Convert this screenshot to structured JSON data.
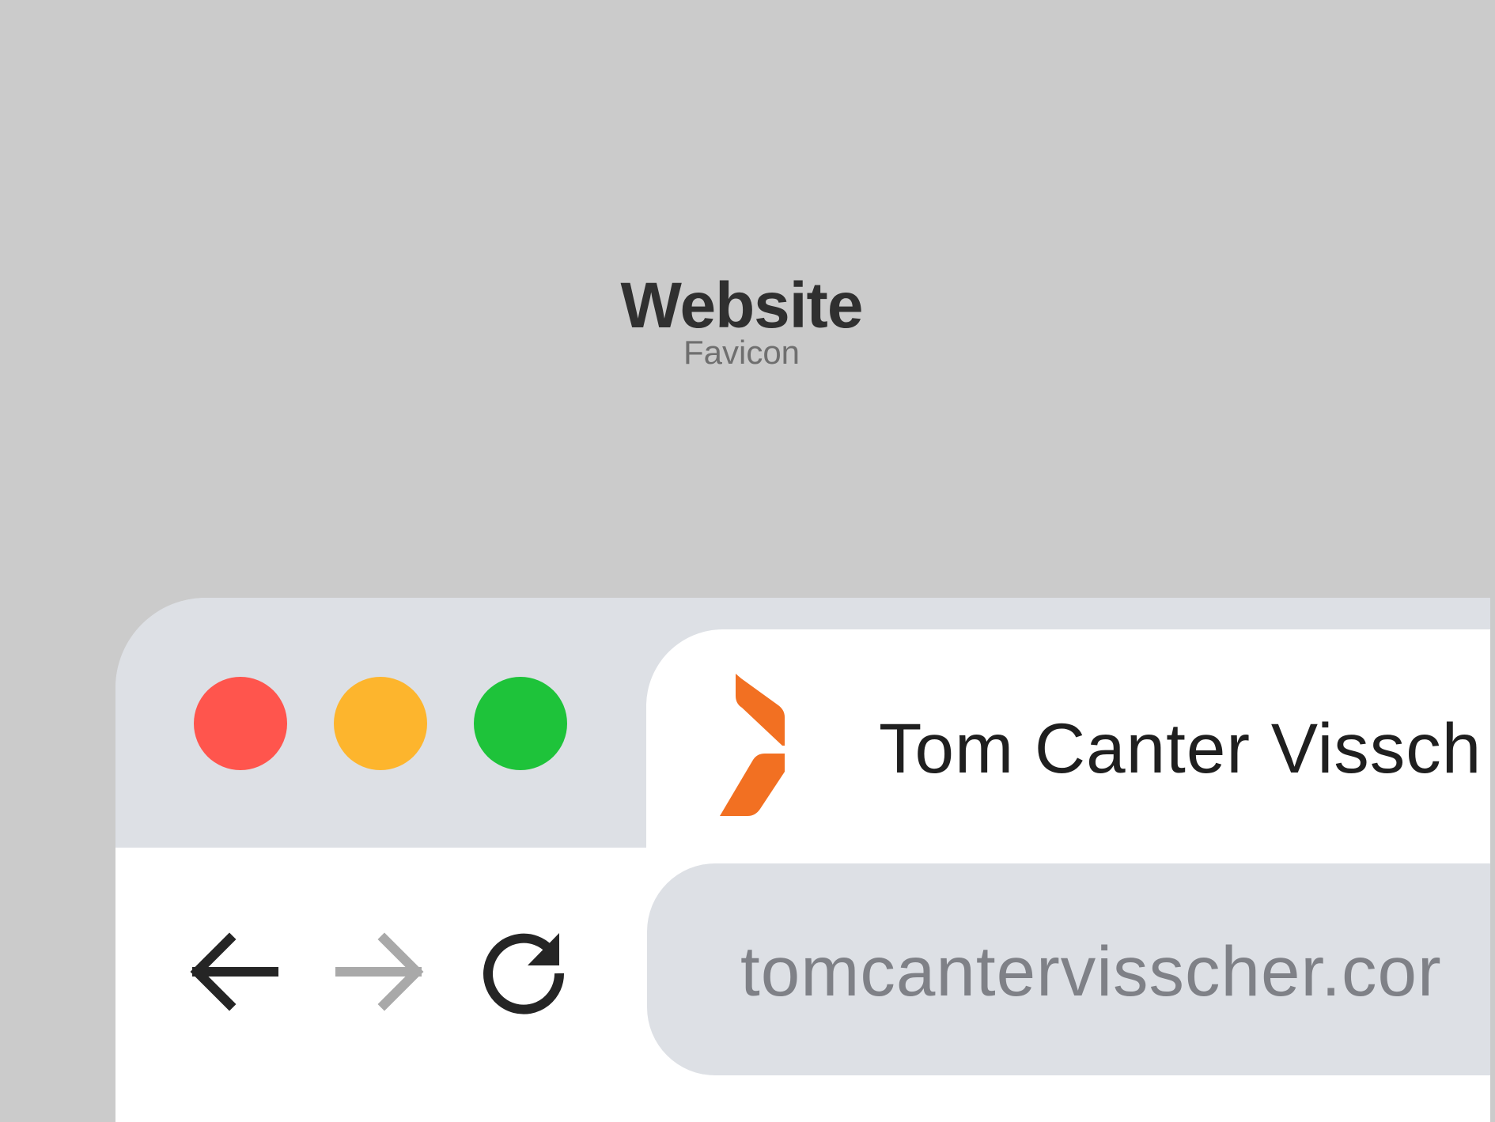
{
  "header": {
    "title": "Website",
    "subtitle": "Favicon"
  },
  "browser": {
    "tab_title": "Tom Canter Vissch",
    "address": "tomcantervisscher.cor",
    "controls": {
      "back": "back-arrow",
      "forward": "forward-arrow",
      "reload": "reload"
    }
  },
  "colors": {
    "background": "#cbcbcb",
    "window_chrome": "#dde0e5",
    "tab_background": "#ffffff",
    "close": "#ff554d",
    "minimize": "#fdb52d",
    "maximize": "#1ec33a",
    "favicon_orange": "#f27022"
  }
}
